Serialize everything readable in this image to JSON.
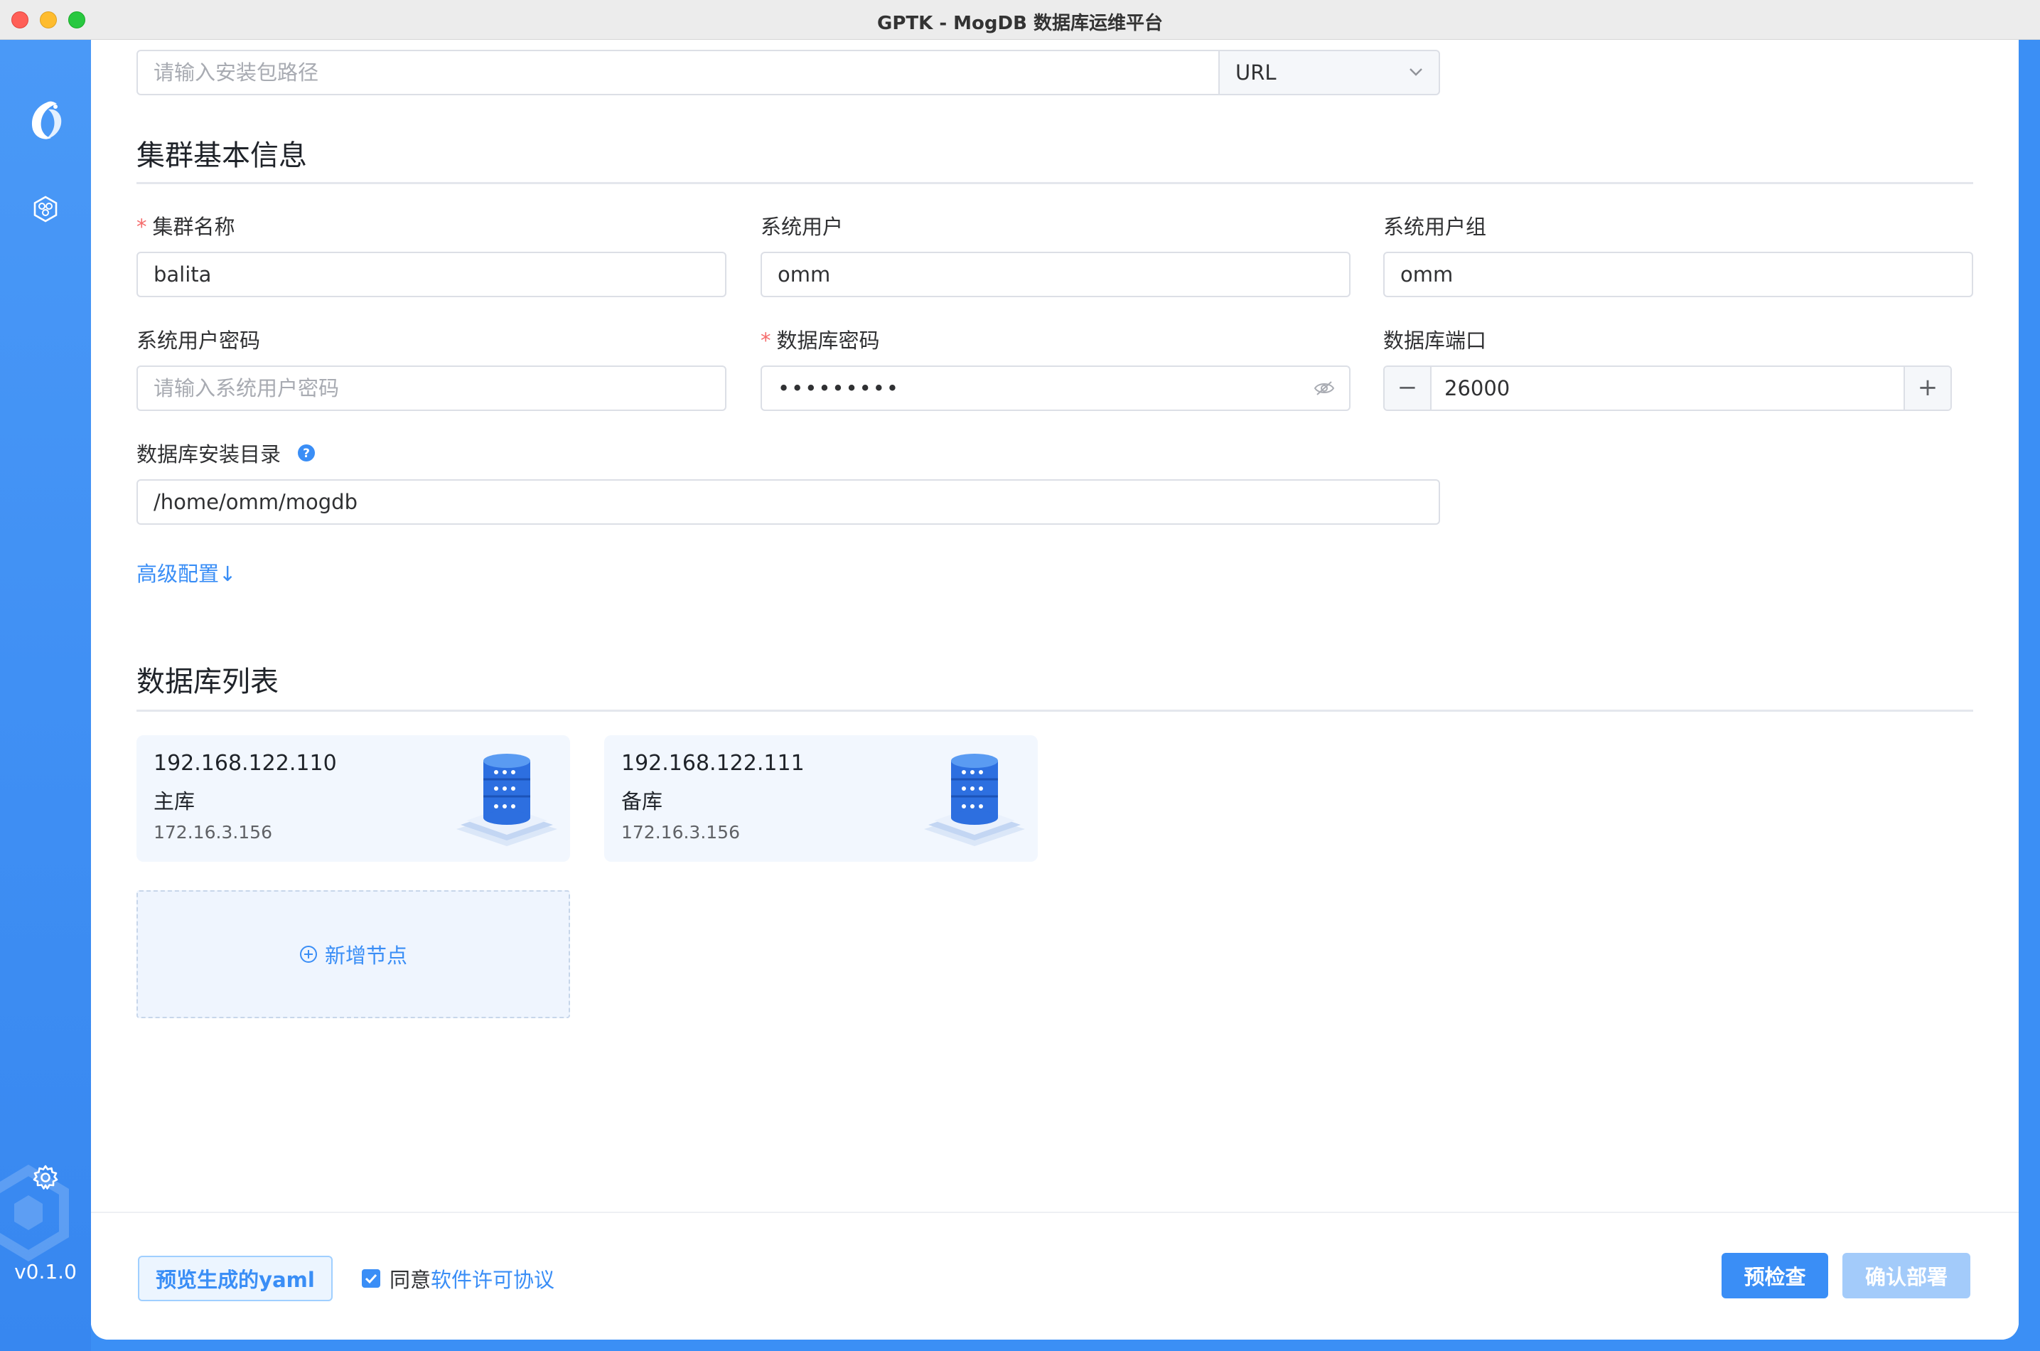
{
  "window": {
    "title": "GPTK - MogDB 数据库运维平台"
  },
  "sidebar": {
    "logo": "mogdb-bird-logo",
    "items": [
      {
        "icon": "cluster-hexagon-icon"
      }
    ],
    "settings_icon": "gear-icon",
    "version": "v0.1.0"
  },
  "package": {
    "path_placeholder": "请输入安装包路径",
    "source_type": "URL"
  },
  "cluster": {
    "section_title": "集群基本信息",
    "name_label": "集群名称",
    "name_value": "balita",
    "sys_user_label": "系统用户",
    "sys_user_value": "omm",
    "sys_group_label": "系统用户组",
    "sys_group_value": "omm",
    "sys_pwd_label": "系统用户密码",
    "sys_pwd_placeholder": "请输入系统用户密码",
    "db_pwd_label": "数据库密码",
    "db_pwd_value": "•••••••••",
    "db_port_label": "数据库端口",
    "db_port_value": "26000",
    "install_dir_label": "数据库安装目录",
    "install_dir_value": "/home/omm/mogdb",
    "advanced_link": "高级配置↓"
  },
  "db_list": {
    "section_title": "数据库列表",
    "nodes": [
      {
        "ip": "192.168.122.110",
        "role": "主库",
        "sub_ip": "172.16.3.156"
      },
      {
        "ip": "192.168.122.111",
        "role": "备库",
        "sub_ip": "172.16.3.156"
      }
    ],
    "add_label": "新增节点"
  },
  "footer": {
    "preview_label": "预览生成的yaml",
    "agree_text": "同意",
    "license_link": "软件许可协议",
    "agree_checked": true,
    "precheck_label": "预检查",
    "deploy_label": "确认部署"
  },
  "colors": {
    "accent": "#3a8ef6",
    "sidebar": "#3e8ef3",
    "required": "#f56c6c",
    "disabled_button": "#a3cbfa"
  }
}
